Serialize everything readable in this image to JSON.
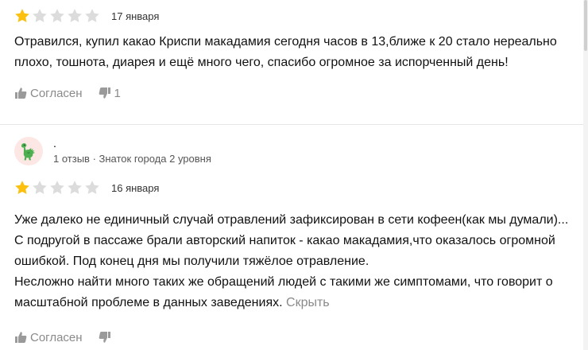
{
  "reviews": [
    {
      "rating": 1,
      "max_rating": 5,
      "date": "17 января",
      "text": [
        "Отравился, купил какао Криспи макадамия сегодня часов в 13,ближе к 20 стало нереально плохо, тошнота, диарея и ещё много чего, спасибо огромное за испорченный день!"
      ],
      "like_label": "Согласен",
      "dislike_count": "1"
    },
    {
      "author_name": ".",
      "author_meta": "1 отзыв · Знаток города 2 уровня",
      "avatar_icon": "dinosaur-icon",
      "rating": 1,
      "max_rating": 5,
      "date": "16 января",
      "text": [
        "Уже далеко не единичный случай отравлений зафиксирован в сети кофеен(как мы думали)...",
        "С подругой в пассаже брали авторский напиток - какао макадамия,что оказалось огромной ошибкой. Под конец дня мы получили тяжёлое отравление.",
        "Несложно найти много таких же обращений людей с такими же симптомами, что говорит о масштабной проблеме в данных заведениях."
      ],
      "hide_label": "Скрыть",
      "like_label": "Согласен",
      "dislike_count": ""
    }
  ],
  "colors": {
    "star_filled": "#fcc10e",
    "star_empty": "#dcdcdc",
    "muted": "#8a8a8a",
    "avatar_bg": "#fde7e4"
  }
}
